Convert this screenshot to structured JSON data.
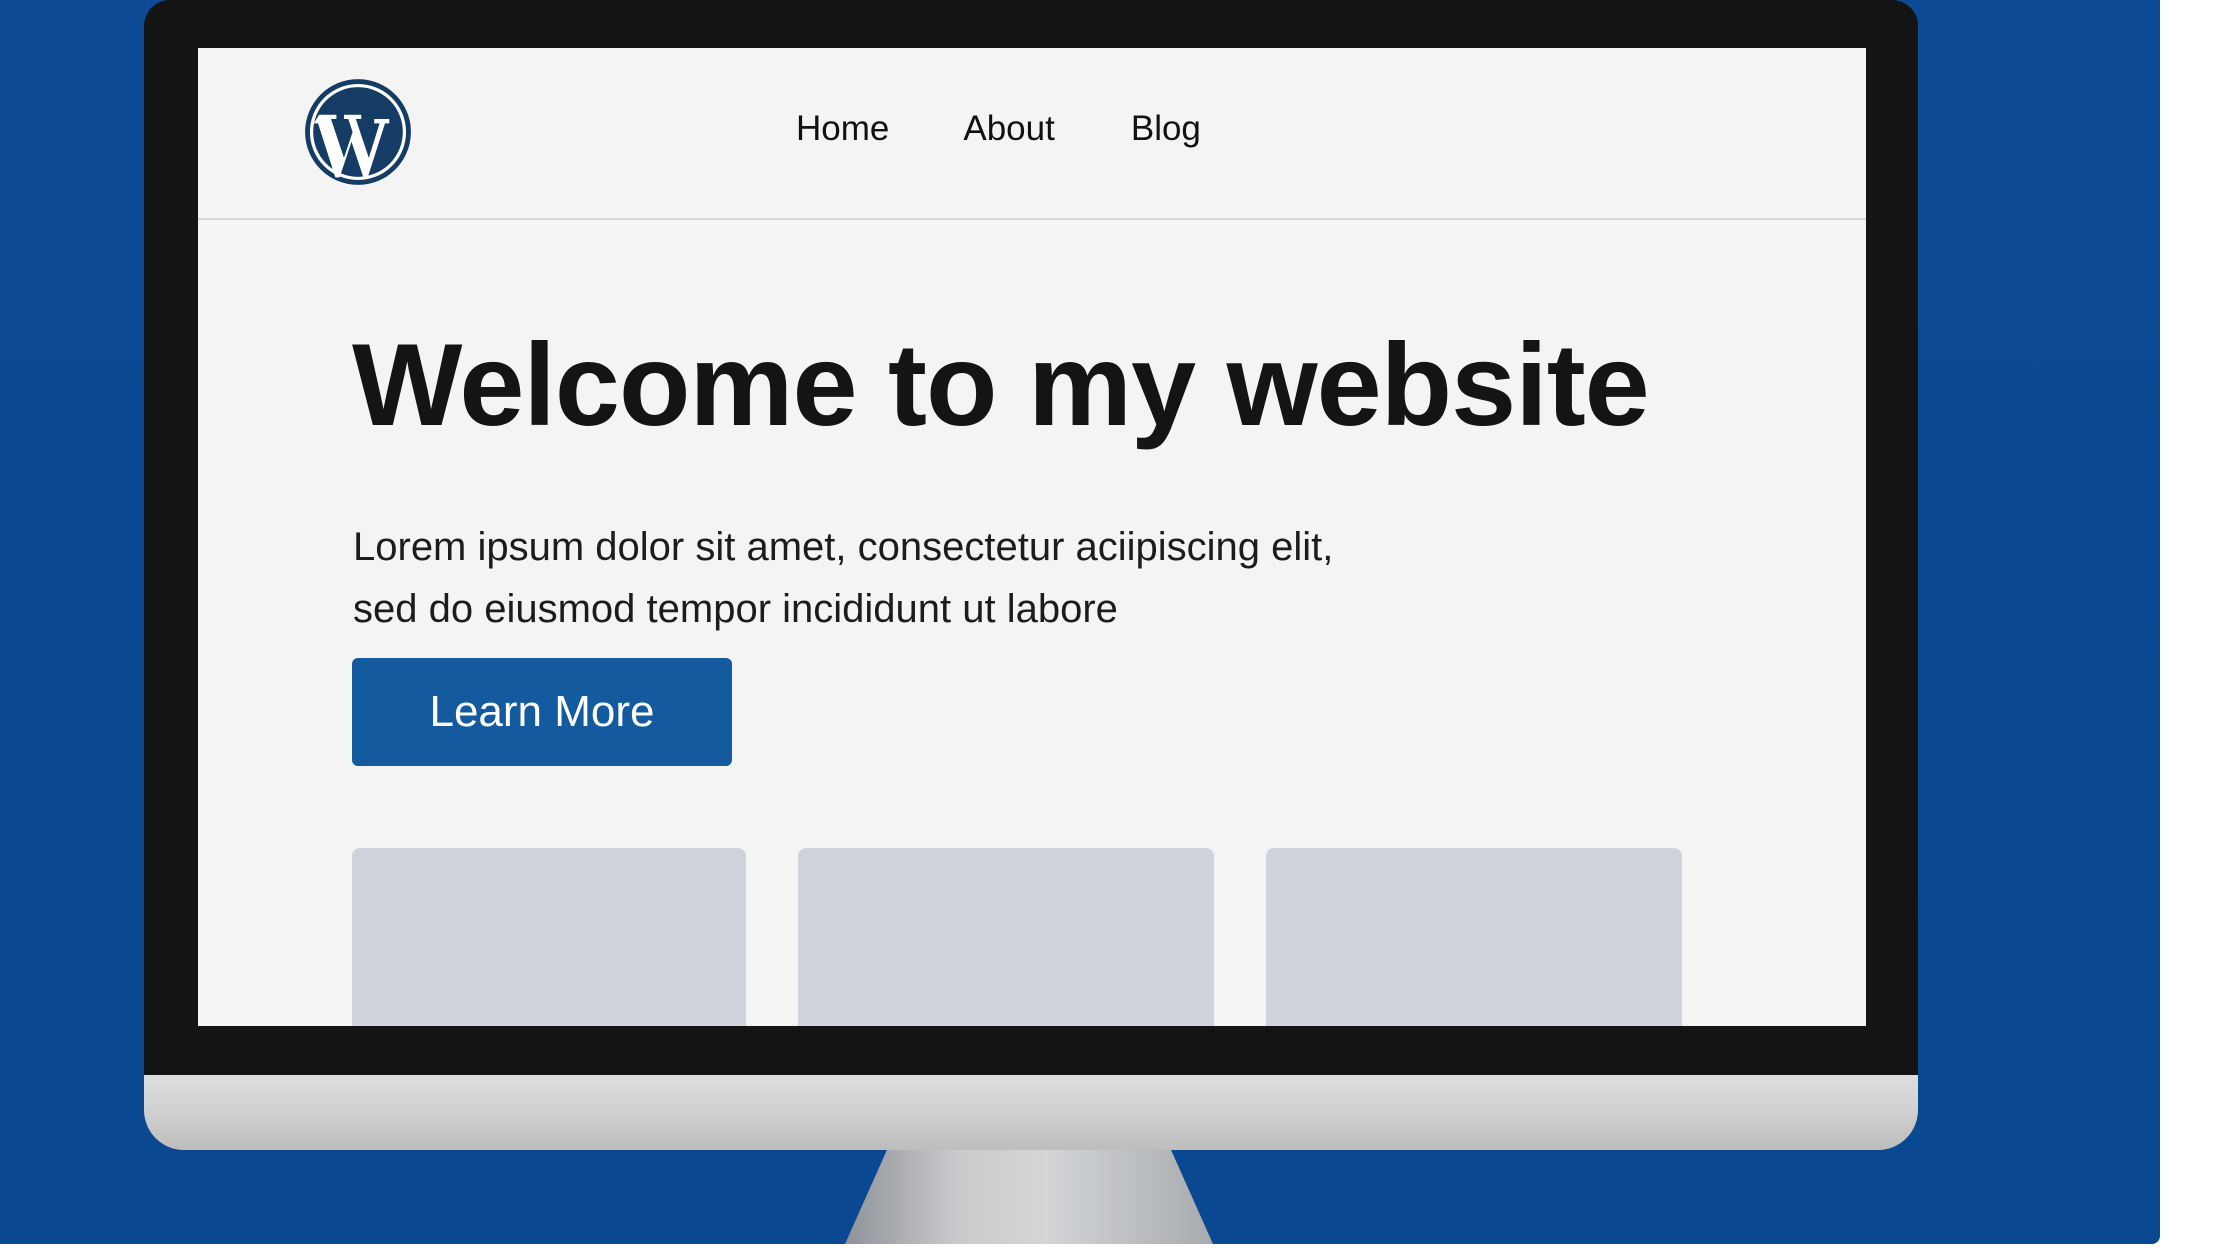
{
  "site": {
    "logo": "wordpress-logo",
    "nav": {
      "items": [
        {
          "label": "Home"
        },
        {
          "label": "About"
        },
        {
          "label": "Blog"
        }
      ]
    },
    "hero": {
      "title": "Welcome to my website",
      "text_line1": "Lorem ipsum dolor sit amet, consectetur aciipiscing elit,",
      "text_line2": "sed do eiusmod tempor incididunt ut labore",
      "cta_label": "Learn More"
    },
    "cards_count": 3
  },
  "colors": {
    "background": "#0d4a96",
    "button": "#135a9e",
    "logo": "#143c64",
    "card": "#cfd4dc",
    "screen": "#f4f4f4"
  }
}
